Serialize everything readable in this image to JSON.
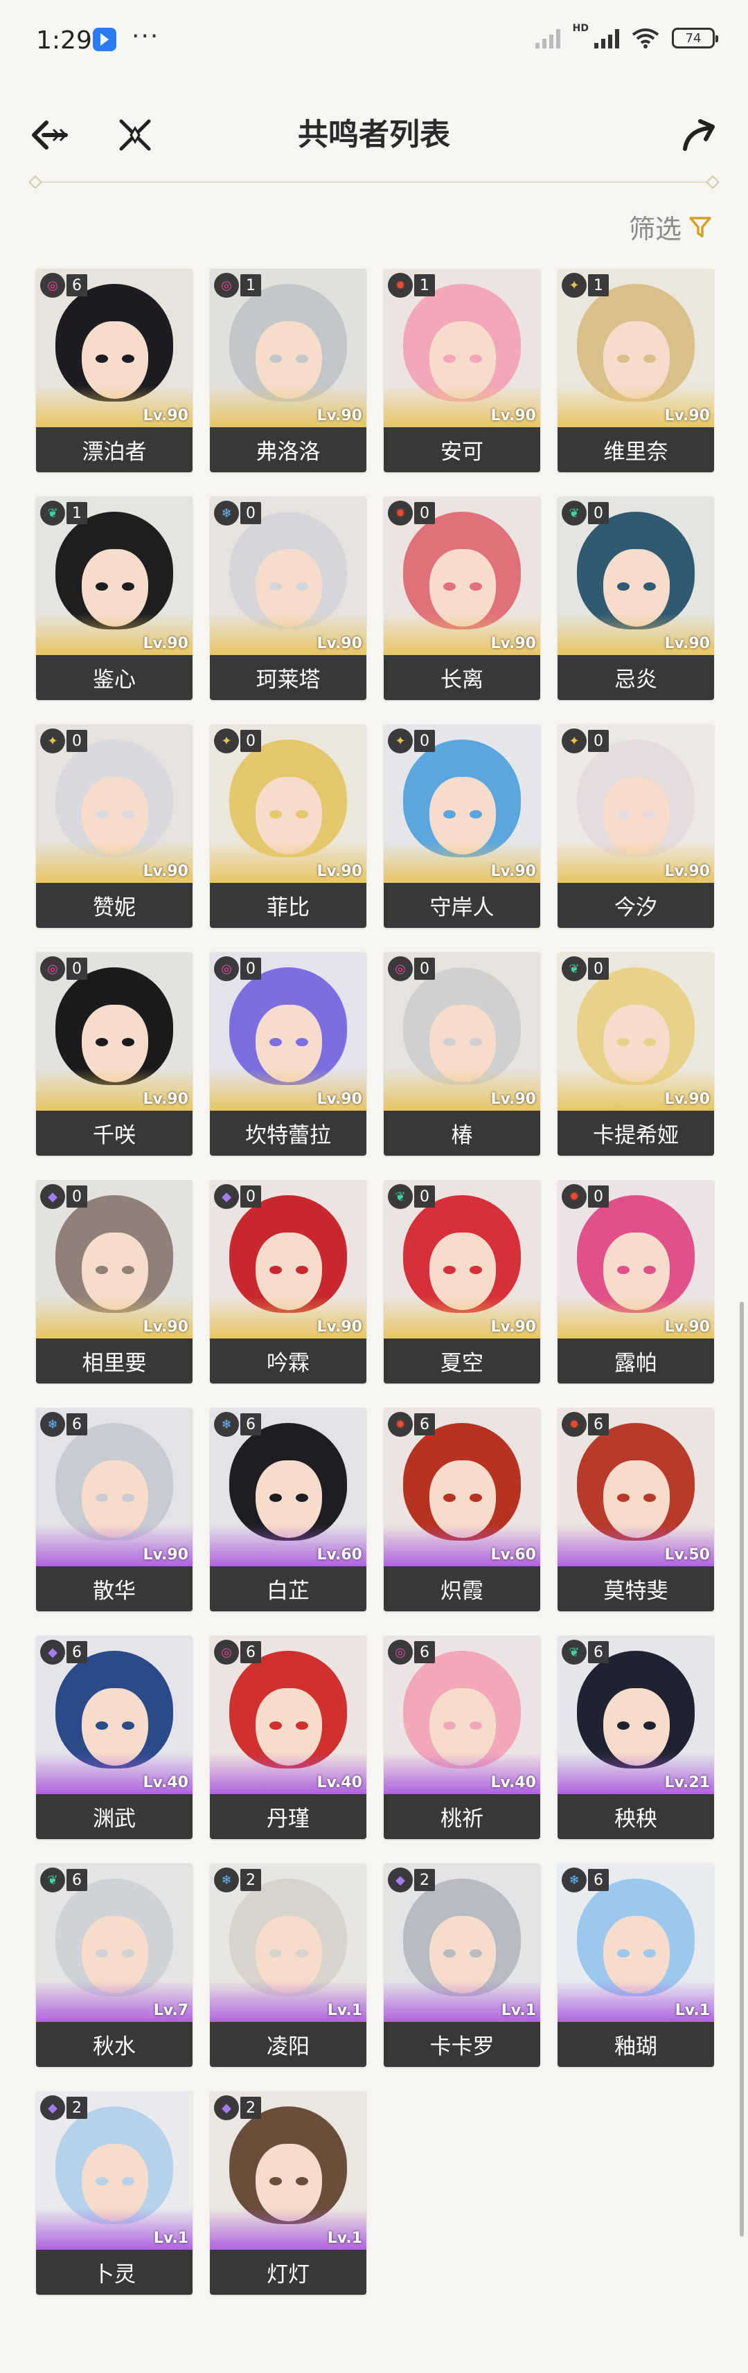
{
  "status_bar": {
    "time": "1:29",
    "battery": "74",
    "network_badge": "HD"
  },
  "header": {
    "title": "共鸣者列表"
  },
  "filter": {
    "label": "筛选"
  },
  "colors": {
    "spectro": "#e9c44a",
    "havoc": "#e04fa0",
    "fusion": "#f04a2e",
    "aero": "#3fd3a0",
    "glacio": "#63b7ff",
    "electro": "#a47cf2",
    "rarity5_glow": "#e8c45c",
    "rarity4_glow": "#ac5cde"
  },
  "characters": [
    {
      "name": "漂泊者",
      "level": "Lv.90",
      "rank": "6",
      "element": "havoc",
      "rarity": 5,
      "hair": "#1c1c22",
      "bg": "#e8e4dc"
    },
    {
      "name": "弗洛洛",
      "level": "Lv.90",
      "rank": "1",
      "element": "havoc",
      "rarity": 5,
      "hair": "#c3c7c9",
      "bg": "#e2e0dc"
    },
    {
      "name": "安可",
      "level": "Lv.90",
      "rank": "1",
      "element": "fusion",
      "rarity": 5,
      "hair": "#f2a8b8",
      "bg": "#ece4e0"
    },
    {
      "name": "维里奈",
      "level": "Lv.90",
      "rank": "1",
      "element": "spectro",
      "rarity": 5,
      "hair": "#d9c08a",
      "bg": "#ebe7dc"
    },
    {
      "name": "鉴心",
      "level": "Lv.90",
      "rank": "1",
      "element": "aero",
      "rarity": 5,
      "hair": "#1e1e20",
      "bg": "#e6e4e0"
    },
    {
      "name": "珂莱塔",
      "level": "Lv.90",
      "rank": "0",
      "element": "glacio",
      "rarity": 5,
      "hair": "#d6d6da",
      "bg": "#e6e3de"
    },
    {
      "name": "长离",
      "level": "Lv.90",
      "rank": "0",
      "element": "fusion",
      "rarity": 5,
      "hair": "#e0707a",
      "bg": "#ece4e0"
    },
    {
      "name": "忌炎",
      "level": "Lv.90",
      "rank": "0",
      "element": "aero",
      "rarity": 5,
      "hair": "#2f5a72",
      "bg": "#e4e4e0"
    },
    {
      "name": "赞妮",
      "level": "Lv.90",
      "rank": "0",
      "element": "spectro",
      "rarity": 5,
      "hair": "#d8dadf",
      "bg": "#e6e3de"
    },
    {
      "name": "菲比",
      "level": "Lv.90",
      "rank": "0",
      "element": "spectro",
      "rarity": 5,
      "hair": "#e5c86e",
      "bg": "#ebe7dc"
    },
    {
      "name": "守岸人",
      "level": "Lv.90",
      "rank": "0",
      "element": "spectro",
      "rarity": 5,
      "hair": "#5aa7e0",
      "bg": "#e4e6ea"
    },
    {
      "name": "今汐",
      "level": "Lv.90",
      "rank": "0",
      "element": "spectro",
      "rarity": 5,
      "hair": "#e6dce0",
      "bg": "#ece8e4"
    },
    {
      "name": "千咲",
      "level": "Lv.90",
      "rank": "0",
      "element": "havoc",
      "rarity": 5,
      "hair": "#1b1b1d",
      "bg": "#e4e2de"
    },
    {
      "name": "坎特蕾拉",
      "level": "Lv.90",
      "rank": "0",
      "element": "havoc",
      "rarity": 5,
      "hair": "#7a6ee0",
      "bg": "#e4e2ea"
    },
    {
      "name": "椿",
      "level": "Lv.90",
      "rank": "0",
      "element": "havoc",
      "rarity": 5,
      "hair": "#d0d0d2",
      "bg": "#e6e3de"
    },
    {
      "name": "卡提希娅",
      "level": "Lv.90",
      "rank": "0",
      "element": "aero",
      "rarity": 5,
      "hair": "#e8d28a",
      "bg": "#ebe7dc"
    },
    {
      "name": "相里要",
      "level": "Lv.90",
      "rank": "0",
      "element": "electro",
      "rarity": 5,
      "hair": "#8f8178",
      "bg": "#e4e2de"
    },
    {
      "name": "吟霖",
      "level": "Lv.90",
      "rank": "0",
      "element": "electro",
      "rarity": 5,
      "hair": "#c8282e",
      "bg": "#ece4e0"
    },
    {
      "name": "夏空",
      "level": "Lv.90",
      "rank": "0",
      "element": "aero",
      "rarity": 5,
      "hair": "#d8303a",
      "bg": "#ece4e0"
    },
    {
      "name": "露帕",
      "level": "Lv.90",
      "rank": "0",
      "element": "fusion",
      "rarity": 5,
      "hair": "#e0508a",
      "bg": "#ece4e4"
    },
    {
      "name": "散华",
      "level": "Lv.90",
      "rank": "6",
      "element": "glacio",
      "rarity": 4,
      "hair": "#c8ccd2",
      "bg": "#e4e2e6"
    },
    {
      "name": "白芷",
      "level": "Lv.60",
      "rank": "6",
      "element": "glacio",
      "rarity": 4,
      "hair": "#1e1e22",
      "bg": "#e4e2e6"
    },
    {
      "name": "炽霞",
      "level": "Lv.60",
      "rank": "6",
      "element": "fusion",
      "rarity": 4,
      "hair": "#b83222",
      "bg": "#ece4e0"
    },
    {
      "name": "莫特斐",
      "level": "Lv.50",
      "rank": "6",
      "element": "fusion",
      "rarity": 4,
      "hair": "#b83a2a",
      "bg": "#ece4e0"
    },
    {
      "name": "渊武",
      "level": "Lv.40",
      "rank": "6",
      "element": "electro",
      "rarity": 4,
      "hair": "#2a4a8a",
      "bg": "#e4e4ea"
    },
    {
      "name": "丹瑾",
      "level": "Lv.40",
      "rank": "6",
      "element": "havoc",
      "rarity": 4,
      "hair": "#d0302e",
      "bg": "#ece4e0"
    },
    {
      "name": "桃祈",
      "level": "Lv.40",
      "rank": "6",
      "element": "havoc",
      "rarity": 4,
      "hair": "#f2a8b8",
      "bg": "#ece4e4"
    },
    {
      "name": "秧秧",
      "level": "Lv.21",
      "rank": "6",
      "element": "aero",
      "rarity": 4,
      "hair": "#1f2230",
      "bg": "#e4e6ea"
    },
    {
      "name": "秋水",
      "level": "Lv.7",
      "rank": "6",
      "element": "aero",
      "rarity": 4,
      "hair": "#cfd2d6",
      "bg": "#e6e4e2"
    },
    {
      "name": "凌阳",
      "level": "Lv.1",
      "rank": "2",
      "element": "glacio",
      "rarity": 4,
      "hair": "#d8d4cc",
      "bg": "#e8e6e2"
    },
    {
      "name": "卡卡罗",
      "level": "Lv.1",
      "rank": "2",
      "element": "electro",
      "rarity": 4,
      "hair": "#b8bcc2",
      "bg": "#e4e4e6"
    },
    {
      "name": "釉瑚",
      "level": "Lv.1",
      "rank": "6",
      "element": "glacio",
      "rarity": 4,
      "hair": "#9cc8ee",
      "bg": "#e8ecf0"
    },
    {
      "name": "卜灵",
      "level": "Lv.1",
      "rank": "2",
      "element": "electro",
      "rarity": 4,
      "hair": "#b6d2ea",
      "bg": "#e8eaee"
    },
    {
      "name": "灯灯",
      "level": "Lv.1",
      "rank": "2",
      "element": "electro",
      "rarity": 4,
      "hair": "#6a4e3c",
      "bg": "#ece6e0"
    }
  ]
}
